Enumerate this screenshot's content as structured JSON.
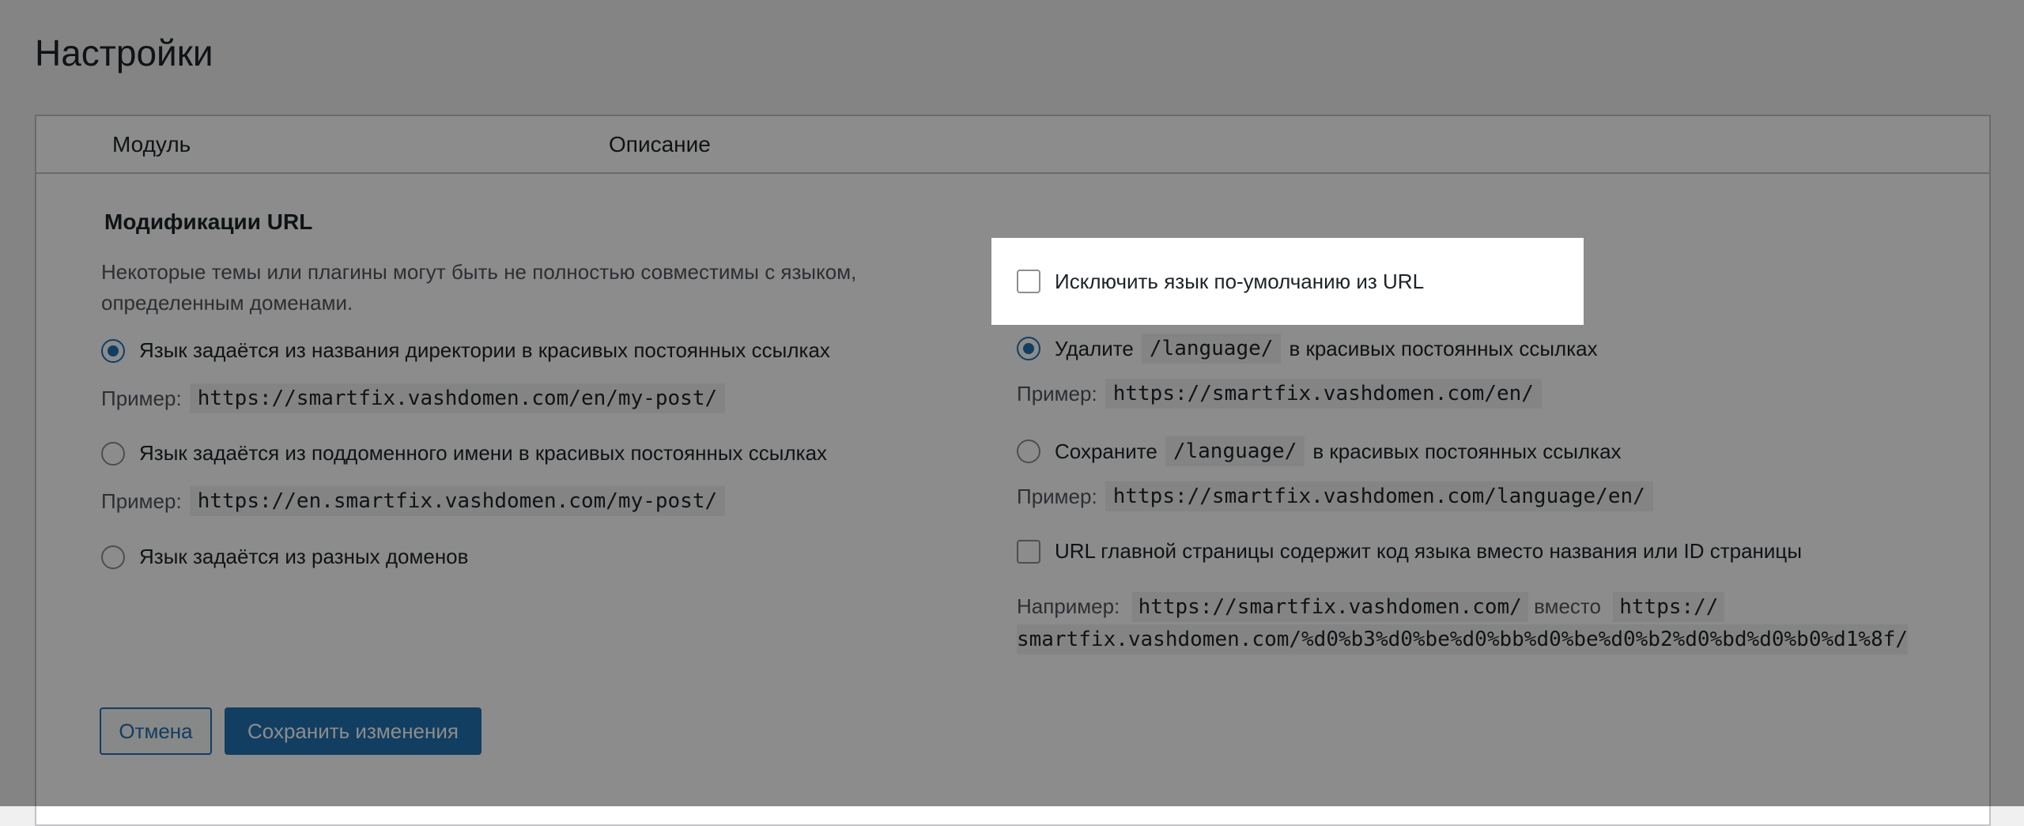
{
  "page": {
    "title": "Настройки"
  },
  "table": {
    "col_module": "Модуль",
    "col_description": "Описание"
  },
  "section": {
    "title": "Модификации URL",
    "description": "Некоторые темы или плагины могут быть не полностью совместимы с языком, определенным доменами."
  },
  "left_options": [
    {
      "label": "Язык задаётся из названия директории в красивых постоянных ссылках",
      "checked": true,
      "example_label": "Пример:",
      "example": "https://smartfix.vashdomen.com/en/my-post/"
    },
    {
      "label": "Язык задаётся из поддоменного имени в красивых постоянных ссылках",
      "checked": false,
      "example_label": "Пример:",
      "example": "https://en.smartfix.vashdomen.com/my-post/"
    },
    {
      "label": "Язык задаётся из разных доменов",
      "checked": false
    }
  ],
  "right_options": {
    "hide_default": {
      "label": "Исключить язык по-умолчанию из URL",
      "checked": false
    },
    "remove": {
      "word_before": "Удалите",
      "code": "/language/",
      "word_after": "в красивых постоянных ссылках",
      "checked": true,
      "example_label": "Пример:",
      "example": "https://smartfix.vashdomen.com/en/"
    },
    "keep": {
      "word_before": "Сохраните",
      "code": "/language/",
      "word_after": "в красивых постоянных ссылках",
      "checked": false,
      "example_label": "Пример:",
      "example": "https://smartfix.vashdomen.com/language/en/"
    },
    "home_url": {
      "label": "URL главной страницы содержит код языка вместо названия или ID страницы",
      "checked": false,
      "example_label": "Например:",
      "example_short": "https://smartfix.vashdomen.com/",
      "instead": "вместо",
      "example_long_part1": "https://",
      "example_long_part2": "smartfix.vashdomen.com/%d0%b3%d0%be%d0%bb%d0%be%d0%b2%d0%bd%d0%b0%d1%8f/"
    }
  },
  "buttons": {
    "cancel": "Отмена",
    "save": "Сохранить изменения"
  },
  "colors": {
    "accent": "#2271b1",
    "overlay": "rgba(0,0,0,0.45)"
  }
}
